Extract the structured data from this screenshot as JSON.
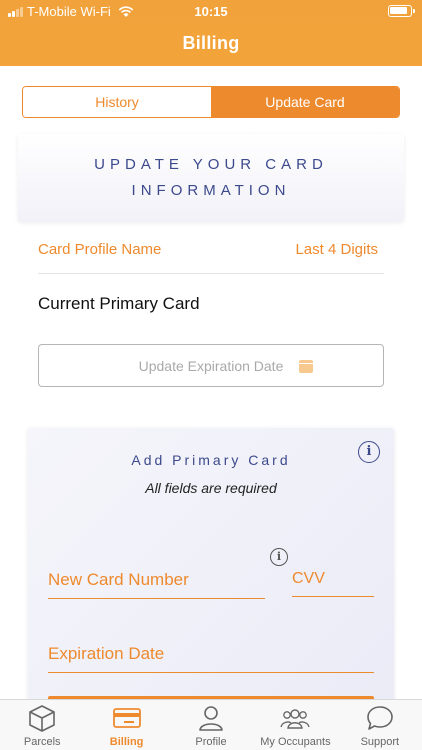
{
  "status_bar": {
    "carrier": "T-Mobile Wi-Fi",
    "time": "10:15"
  },
  "header": {
    "title": "Billing"
  },
  "segmented": {
    "history_label": "History",
    "update_card_label": "Update Card",
    "selected": "Update Card"
  },
  "banner": {
    "line1": "UPDATE YOUR CARD",
    "line2": "INFORMATION"
  },
  "card_table": {
    "col_name": "Card Profile Name",
    "col_digits": "Last 4 Digits",
    "current_card": "Current Primary Card"
  },
  "update_expiration": {
    "label": "Update Expiration Date",
    "icon": "calendar-icon"
  },
  "add_card": {
    "title": "Add Primary Card",
    "subtitle": "All fields are required",
    "card_number_placeholder": "New Card Number",
    "cvv_placeholder": "CVV",
    "expiration_placeholder": "Expiration Date"
  },
  "tabbar": {
    "items": [
      {
        "label": "Parcels",
        "icon": "box-icon"
      },
      {
        "label": "Billing",
        "icon": "credit-card-icon",
        "active": true
      },
      {
        "label": "Profile",
        "icon": "person-icon"
      },
      {
        "label": "My Occupants",
        "icon": "group-icon"
      },
      {
        "label": "Support",
        "icon": "chat-bubble-icon"
      }
    ]
  },
  "colors": {
    "accent": "#ee8a2e",
    "header": "#f1a23a",
    "navy": "#3c4a8c"
  }
}
